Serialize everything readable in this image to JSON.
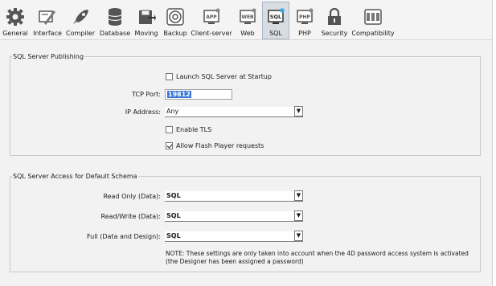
{
  "toolbar": {
    "items": [
      {
        "label": "General",
        "icon": "gear-icon"
      },
      {
        "label": "Interface",
        "icon": "interface-icon"
      },
      {
        "label": "Compiler",
        "icon": "rocket-icon"
      },
      {
        "label": "Database",
        "icon": "database-icon"
      },
      {
        "label": "Moving",
        "icon": "moving-icon"
      },
      {
        "label": "Backup",
        "icon": "backup-icon"
      },
      {
        "label": "Client-server",
        "icon": "client-server-icon"
      },
      {
        "label": "Web",
        "icon": "web-icon"
      },
      {
        "label": "SQL",
        "icon": "sql-icon",
        "active": true
      },
      {
        "label": "PHP",
        "icon": "php-icon"
      },
      {
        "label": "Security",
        "icon": "lock-icon"
      },
      {
        "label": "Compatibility",
        "icon": "compatibility-icon"
      }
    ]
  },
  "publishing": {
    "legend": "SQL Server Publishing",
    "launch_label": "Launch SQL Server at Startup",
    "launch_checked": false,
    "tcp_port_label": "TCP Port:",
    "tcp_port_value": "19812",
    "ip_label": "IP Address:",
    "ip_value": "Any",
    "tls_label": "Enable TLS",
    "tls_checked": false,
    "flash_label": "Allow Flash Player requests",
    "flash_checked": true
  },
  "access": {
    "legend": "SQL Server Access for Default Schema",
    "read_only_label": "Read Only (Data):",
    "read_only_value": "SQL",
    "read_write_label": "Read/Write (Data):",
    "read_write_value": "SQL",
    "full_label": "Full (Data and Design):",
    "full_value": "SQL",
    "note": "NOTE: These settings are only taken into account when the 4D password access system is activated (the Designer has been assigned a password)"
  },
  "colors": {
    "selection": "#3875d7",
    "active_tab": "#d7dde3"
  }
}
